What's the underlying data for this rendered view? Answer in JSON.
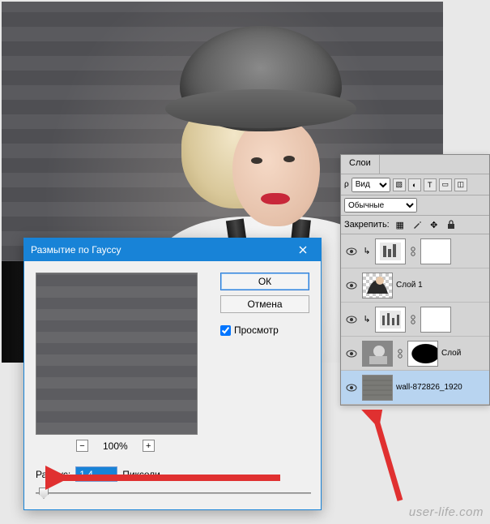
{
  "dialog": {
    "title": "Размытие по Гауссу",
    "ok": "ОК",
    "cancel": "Отмена",
    "preview_checkbox": "Просмотр",
    "zoom_percent": "100%",
    "radius_label": "Радиус:",
    "radius_value": "1,4",
    "radius_unit": "Пиксели"
  },
  "layers_panel": {
    "tab": "Слои",
    "filter_kind": "Вид",
    "blend_mode": "Обычные",
    "lock_label": "Закрепить:",
    "layers": [
      {
        "name": "",
        "kind": "adjustment-curves"
      },
      {
        "name": "Слой 1",
        "kind": "pixel"
      },
      {
        "name": "",
        "kind": "adjustment-levels"
      },
      {
        "name": "Слой",
        "kind": "pixel-mask"
      },
      {
        "name": "wall-872826_1920",
        "kind": "pixel",
        "selected": true
      }
    ]
  },
  "watermark": "user-life.com"
}
